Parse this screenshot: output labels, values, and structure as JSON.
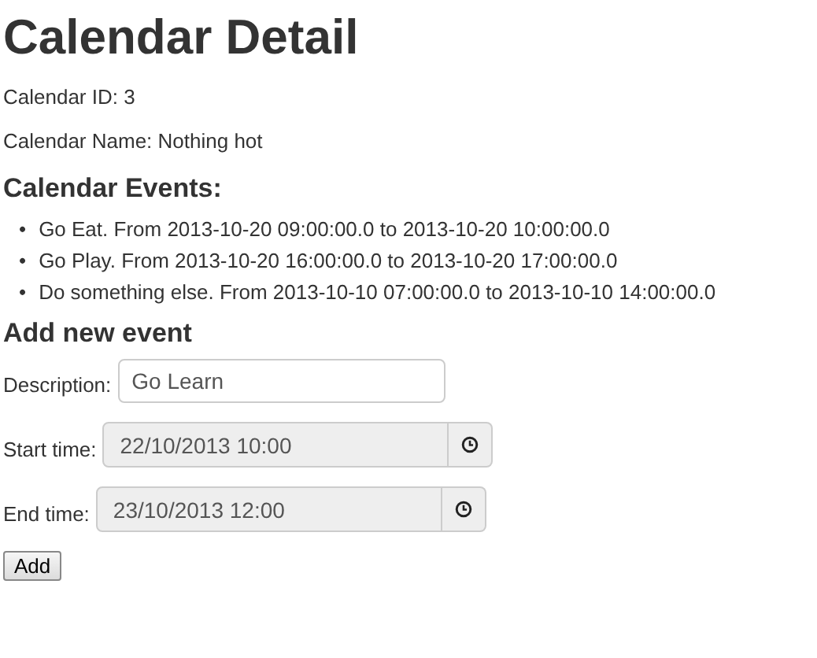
{
  "title": "Calendar Detail",
  "calendar_id": "Calendar ID: 3",
  "calendar_name": "Calendar Name: Nothing hot",
  "events_heading": "Calendar Events:",
  "events": [
    {
      "bullet": "•",
      "text": "Go Eat. From 2013-10-20 09:00:00.0 to 2013-10-20 10:00:00.0"
    },
    {
      "bullet": "•",
      "text": "Go Play. From 2013-10-20 16:00:00.0 to 2013-10-20 17:00:00.0"
    },
    {
      "bullet": "•",
      "text": "Do something else. From 2013-10-10 07:00:00.0 to 2013-10-10 14:00:00.0"
    }
  ],
  "form_heading": "Add new event",
  "fields": [
    {
      "label": "Description:",
      "value": "Go Learn",
      "kind": "text",
      "disabled": false
    },
    {
      "label": "Start time:",
      "value": "22/10/2013 10:00",
      "kind": "datetime",
      "disabled": true
    },
    {
      "label": "End time:",
      "value": "23/10/2013 12:00",
      "kind": "datetime",
      "disabled": true
    }
  ],
  "button": "Add"
}
